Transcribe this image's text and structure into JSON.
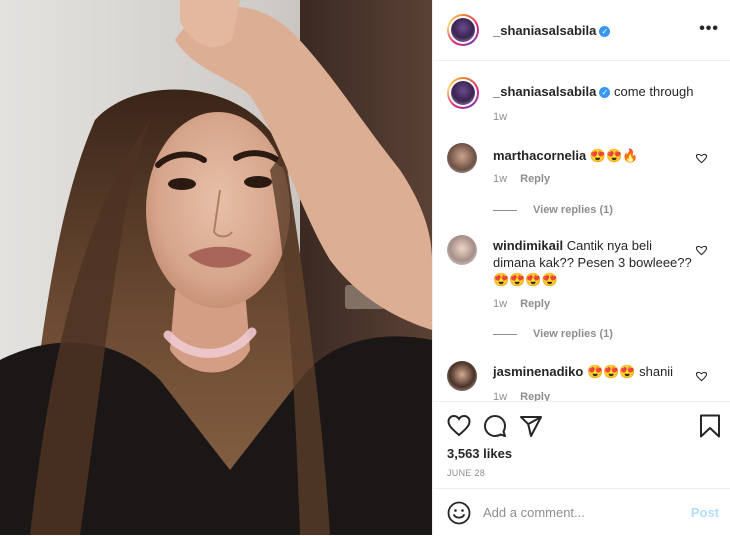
{
  "post": {
    "author": "_shaniasalsabila",
    "more_glyph": "•••"
  },
  "caption": {
    "username": "_shaniasalsabila",
    "text": "come through",
    "time": "1w"
  },
  "comments": [
    {
      "username": "marthacornelia",
      "text": "😍😍🔥",
      "time": "1w",
      "reply_label": "Reply",
      "view_replies": "View replies (1)"
    },
    {
      "username": "windimikail",
      "text": "Cantik nya beli dimana kak?? Pesen 3 bowleee?? 😍😍😍😍",
      "time": "1w",
      "reply_label": "Reply",
      "view_replies": "View replies (1)"
    },
    {
      "username": "jasminenadiko",
      "text": "😍😍😍 shanii",
      "time": "1w",
      "reply_label": "Reply"
    }
  ],
  "footer": {
    "likes": "3,563 likes",
    "date": "JUNE 28",
    "comment_placeholder": "Add a comment...",
    "post_label": "Post"
  },
  "icons": {
    "verified": "verified-badge-icon",
    "like": "heart-icon",
    "comment": "comment-bubble-icon",
    "share": "paper-plane-icon",
    "save": "bookmark-icon",
    "emoji": "emoji-smiley-icon"
  },
  "colors": {
    "verified_blue": "#3897f0",
    "post_button_disabled": "#b2dffc",
    "secondary_text": "#8e8e8e"
  }
}
